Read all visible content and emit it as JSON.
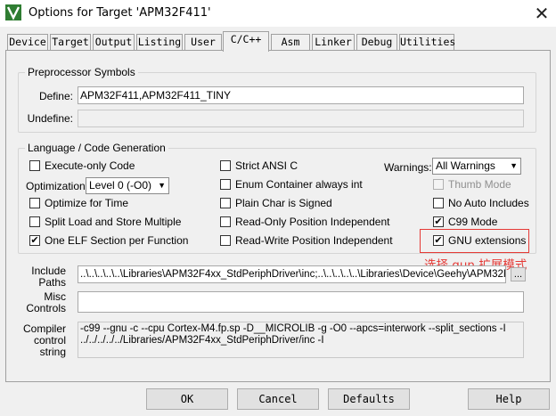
{
  "window": {
    "title": "Options for Target 'APM32F411'",
    "app_icon": "keil-uvision-icon",
    "close_glyph": "✕"
  },
  "tabs": [
    "Device",
    "Target",
    "Output",
    "Listing",
    "User",
    "C/C++",
    "Asm",
    "Linker",
    "Debug",
    "Utilities"
  ],
  "active_tab": "C/C++",
  "preprocessor": {
    "legend": "Preprocessor Symbols",
    "define_label": "Define:",
    "define_value": "APM32F411,APM32F411_TINY",
    "undefine_label": "Undefine:",
    "undefine_value": ""
  },
  "language": {
    "legend": "Language / Code Generation",
    "execute_only": {
      "label": "Execute-only Code",
      "checked": false
    },
    "optimization_label": "Optimization:",
    "optimization_value": "Level 0 (-O0)",
    "optimize_time": {
      "label": "Optimize for Time",
      "checked": false
    },
    "split_load": {
      "label": "Split Load and Store Multiple",
      "checked": false
    },
    "one_elf": {
      "label": "One ELF Section per Function",
      "checked": true
    },
    "strict_ansi": {
      "label": "Strict ANSI C",
      "checked": false
    },
    "enum_container": {
      "label": "Enum Container always int",
      "checked": false
    },
    "plain_char": {
      "label": "Plain Char is Signed",
      "checked": false
    },
    "ro_position": {
      "label": "Read-Only Position Independent",
      "checked": false
    },
    "rw_position": {
      "label": "Read-Write Position Independent",
      "checked": false
    },
    "warnings_label": "Warnings:",
    "warnings_value": "All Warnings",
    "thumb_mode": {
      "label": "Thumb Mode",
      "checked": false,
      "disabled": true
    },
    "no_auto_includes": {
      "label": "No Auto Includes",
      "checked": false
    },
    "c99_mode": {
      "label": "C99 Mode",
      "checked": true
    },
    "gnu_extensions": {
      "label": "GNU extensions",
      "checked": true
    }
  },
  "annotation": {
    "text": "选择 gun 扩展模式",
    "color": "#e53935"
  },
  "include_paths": {
    "label": "Include Paths",
    "value": "..\\..\\..\\..\\..\\Libraries\\APM32F4xx_StdPeriphDriver\\inc;..\\..\\..\\..\\..\\Libraries\\Device\\Geehy\\APM32F4",
    "browse_label": "..."
  },
  "misc_controls": {
    "label": "Misc Controls",
    "value": ""
  },
  "compiler_control": {
    "label": "Compiler control string",
    "value": "-c99 --gnu -c --cpu Cortex-M4.fp.sp -D__MICROLIB -g -O0 --apcs=interwork --split_sections -I\n../../../../../Libraries/APM32F4xx_StdPeriphDriver/inc -I"
  },
  "buttons": {
    "ok": "OK",
    "cancel": "Cancel",
    "defaults": "Defaults",
    "help": "Help"
  },
  "check_glyph": "✔",
  "dropdown_glyph": "▼"
}
